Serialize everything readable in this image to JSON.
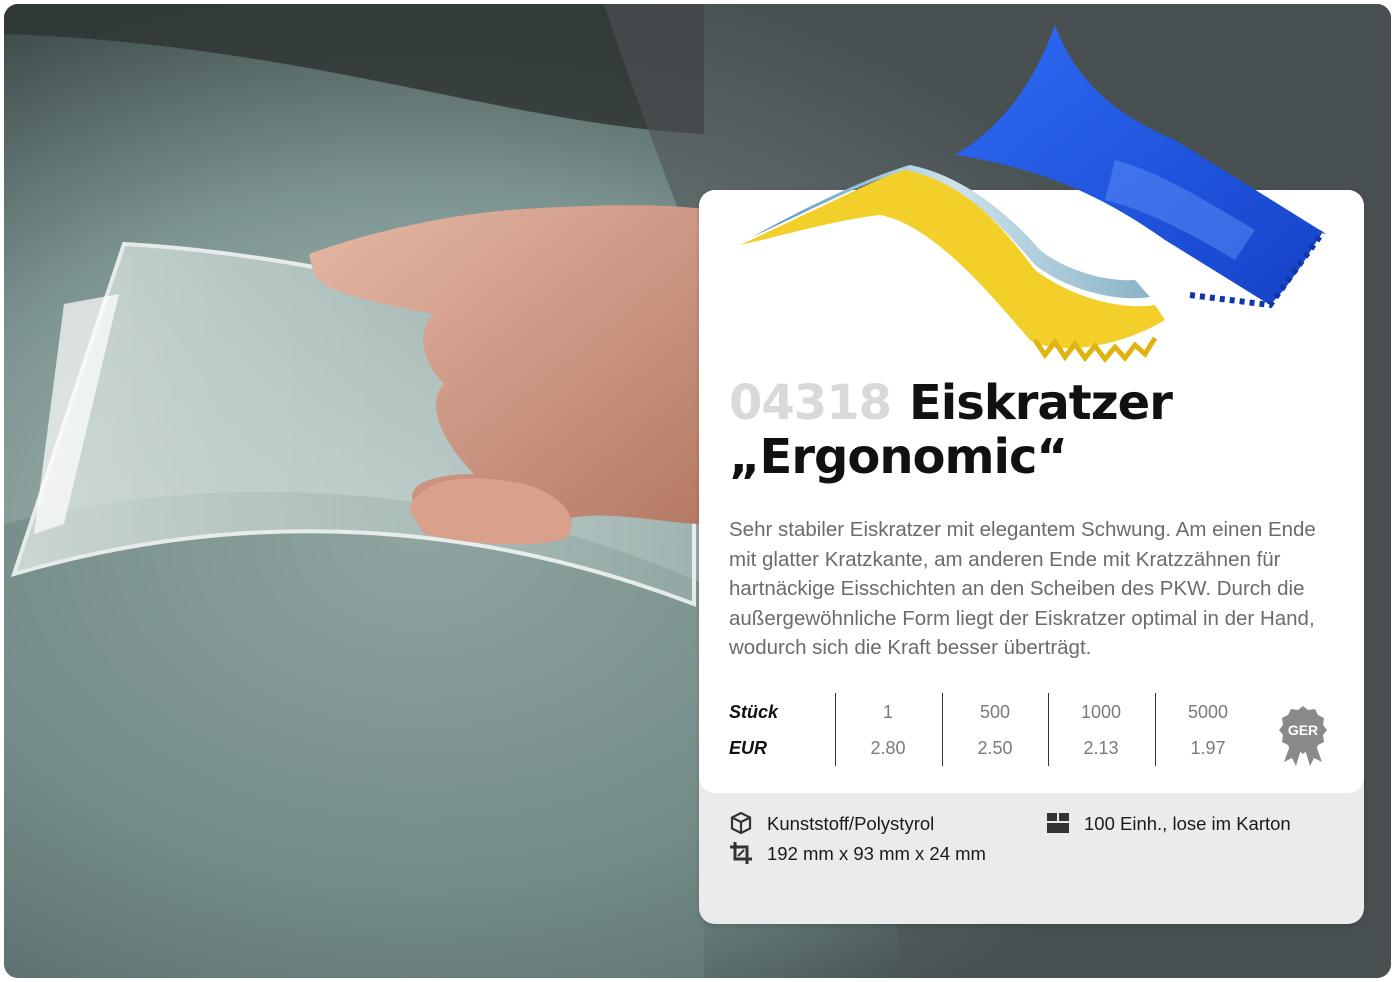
{
  "product": {
    "sku": "04318",
    "title_line1": "Eiskratzer",
    "title_line2": "„Ergonomic“",
    "description": "Sehr stabiler Eiskratzer mit elegantem Schwung. Am einen Ende mit glatter Kratzkante, am anderen Ende mit Kratzzähnen für hartnäckige Eisschichten an den Scheiben des PKW. Durch die außergewöhnliche Form liegt der Eiskratzer optimal in der Hand, wodurch sich die Kraft besser überträgt."
  },
  "pricing": {
    "qty_label": "Stück",
    "price_label": "EUR",
    "quantities": [
      "1",
      "500",
      "1000",
      "5000"
    ],
    "prices": [
      "2.80",
      "2.50",
      "2.13",
      "1.97"
    ]
  },
  "badge": {
    "text": "GER",
    "icon": "award-ribbon-icon"
  },
  "specs": {
    "material": "Kunststoff/Polystyrol",
    "dimensions": "192 mm x 93 mm x 24 mm",
    "packaging": "100 Einh., lose im Karton",
    "material_icon": "cube-icon",
    "dimensions_icon": "crop-icon",
    "packaging_icon": "box-icon"
  },
  "colors": {
    "scraper_blue": "#1f5ee8",
    "scraper_yellow": "#f3cf2a",
    "sku_gray": "#d9d9d9"
  }
}
